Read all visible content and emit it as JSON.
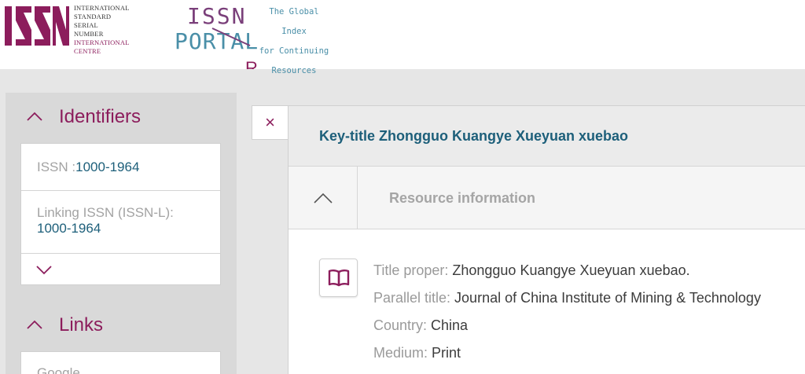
{
  "header": {
    "issn_logo": {
      "mark": "ISSN",
      "lines": [
        "INTERNATIONAL",
        "STANDARD",
        "SERIAL",
        "NUMBER"
      ],
      "accent_line": "INTERNATIONAL CENTRE"
    },
    "portal_logo": {
      "word_top": "ISSN",
      "word_bottom": "PORTAL",
      "tagline": [
        "The Global Index",
        "for Continuing",
        "Resources"
      ]
    },
    "peek_char": "R"
  },
  "sidebar": {
    "identifiers": {
      "title": "Identifiers",
      "issn_label": "ISSN :",
      "issn_value": "1000-1964",
      "linking_label": "Linking ISSN (ISSN-L):",
      "linking_value": "1000-1964"
    },
    "links": {
      "title": "Links",
      "first_item": "Google"
    }
  },
  "record": {
    "close_symbol": "×",
    "key_title": "Key-title Zhongguo Kuangye Xueyuan xuebao",
    "resource_section_title": "Resource information",
    "fields": [
      {
        "label": "Title proper: ",
        "value": "Zhongguo Kuangye Xueyuan xuebao."
      },
      {
        "label": "Parallel title: ",
        "value": "Journal of China Institute of Mining & Technology"
      },
      {
        "label": "Country: ",
        "value": "China"
      },
      {
        "label": "Medium: ",
        "value": "Print"
      }
    ]
  },
  "colors": {
    "brand": "#8c1d5c",
    "link": "#1d5f7a",
    "portal": "#4a8fa8"
  },
  "icons": [
    "chevron-up-icon",
    "chevron-down-icon",
    "close-icon",
    "book-icon"
  ]
}
